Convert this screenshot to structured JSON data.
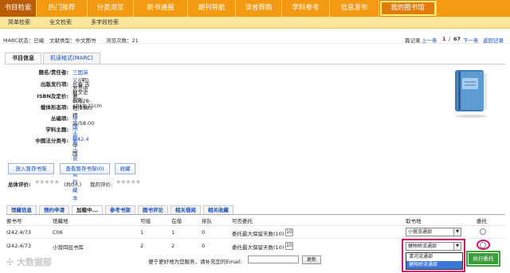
{
  "topnav": {
    "items": [
      "书目检索",
      "热门推荐",
      "分类浏览",
      "新书通报",
      "期刊导航",
      "读者荐购",
      "学科参考",
      "信息发布",
      "我的图书馆"
    ]
  },
  "subnav": {
    "items": [
      "简单检索",
      "全文检索",
      "多字段检索"
    ]
  },
  "infobar": {
    "marc_status": "MARC状态：已编",
    "doc_type": "文献类型：中文图书",
    "views": "浏览次数：21",
    "nav_label": "篇记录",
    "prev": "上一条",
    "current": "1",
    "sep": "/",
    "total": "67",
    "next": "下一条",
    "back": "返回记录"
  },
  "tabs": {
    "info": "书目信息",
    "marc": "机读格式(MARC)"
  },
  "fields": [
    {
      "label": "题名/责任者:",
      "value_link": "三国演义",
      "value_rest": "/(明)罗贯中著"
    },
    {
      "label": "出版发行项:",
      "value_link": "",
      "value_rest": "长春:吉林文史出版社,1995"
    },
    {
      "label": "ISBN及定价:",
      "value_link": "",
      "value_rest": "7-80528-980-8 精装/58.00"
    },
    {
      "label": "载体形态项:",
      "value_link": "",
      "value_rest": "1059;21cm"
    },
    {
      "label": "丛编项:",
      "value_link": "中国古典小说名著珍藏本",
      "value_rest": ""
    },
    {
      "label": "学科主题:",
      "value_link": "小说",
      "value_rest": "-中国"
    },
    {
      "label": "中图法分类号:",
      "value_link": "I242.4",
      "value_rest": ""
    }
  ],
  "cover_icon": "book-cover-icon",
  "buttons": {
    "add_shelf": "放入暂存书架",
    "view_shelf": "查看暂存书架(0)",
    "favorite": "收藏"
  },
  "rating": {
    "total_label": "总体评价:",
    "total_count": "(共0人)",
    "mine_label": "我的评价:"
  },
  "btabs": [
    "馆藏信息",
    "预约申请",
    "加载中...",
    "参考书架",
    "图书评论",
    "相关借阅",
    "相关收藏"
  ],
  "table": {
    "headers": [
      "索书号",
      "馆藏地",
      "可借",
      "在借",
      "排队",
      "可否委托",
      "取书地",
      "委托"
    ],
    "rows": [
      {
        "call": "I242.4/73",
        "loc": "C06",
        "avail": "1",
        "out": "1",
        "queue": "0",
        "entrust": "委托最大保留天数(10)",
        "days": "10",
        "pickup": "小营流通部"
      },
      {
        "call": "I242.4/73",
        "loc": "小营四层书库",
        "avail": "2",
        "out": "2",
        "queue": "0",
        "entrust": "委托最大保留天数(10)",
        "days": "10",
        "pickup": "健翔桥流通部"
      }
    ]
  },
  "dropdown": {
    "options": [
      "清河流通部",
      "健翔桥流通部"
    ]
  },
  "mail": {
    "label": "便于更好地为您服务，请补充您的Email:",
    "button": "更新"
  },
  "exec_button": "执行委托",
  "watermark": "大数据部",
  "colors": {
    "accent": "#f39a12",
    "nav_active": "#b85d05",
    "highlight": "#d4166d",
    "exec": "#3d9c3d"
  }
}
